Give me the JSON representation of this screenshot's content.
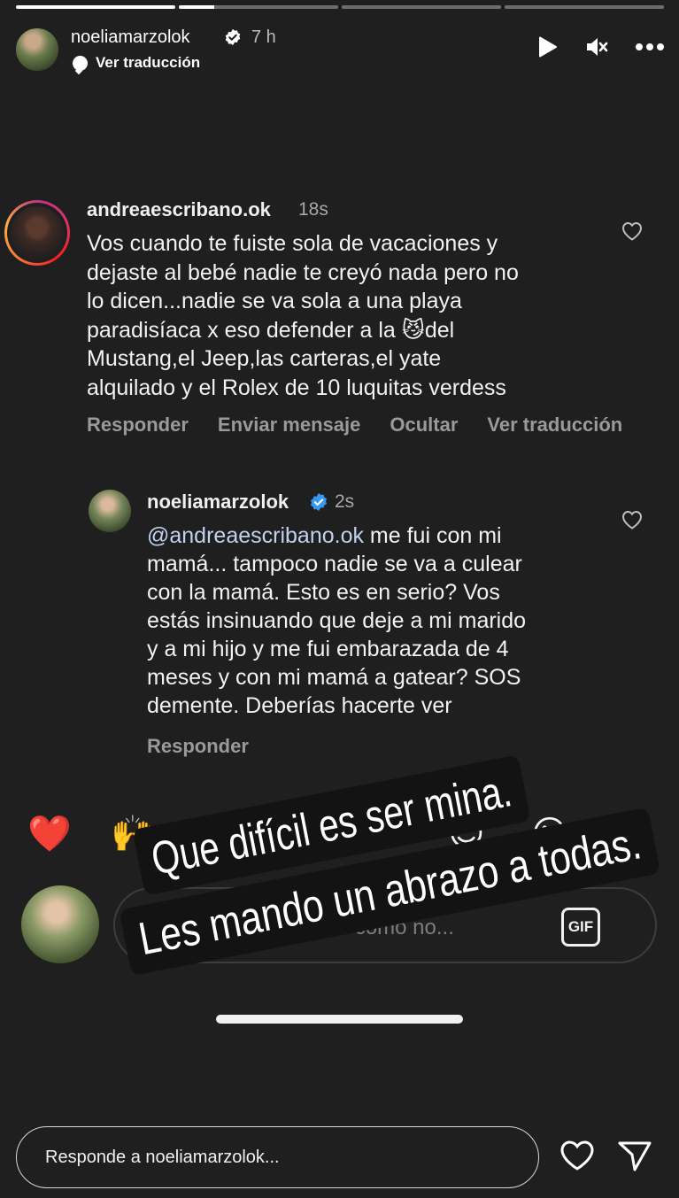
{
  "progress": {
    "segments": [
      {
        "fill": 1.0
      },
      {
        "fill": 0.22
      },
      {
        "fill": 0
      },
      {
        "fill": 0
      }
    ]
  },
  "story_header": {
    "username": "noeliamarzolok",
    "time": "7 h",
    "translate_label": "Ver traducción",
    "icons": [
      "play-icon",
      "mute-icon",
      "more-icon"
    ]
  },
  "comment": {
    "username": "andreaescribano.ok",
    "time": "18s",
    "lines": [
      "Vos cuando te fuiste sola de vacaciones y",
      "dejaste al bebé nadie te creyó nada pero no",
      "lo dicen...nadie se va sola a una playa",
      "paradisíaca x eso defender a la 😼del",
      "Mustang,el Jeep,las carteras,el yate",
      "alquilado y el Rolex de 10 luquitas verdess"
    ],
    "actions": [
      "Responder",
      "Enviar mensaje",
      "Ocultar",
      "Ver traducción"
    ]
  },
  "reply": {
    "username": "noeliamarzolok",
    "time": "2s",
    "mention": "@andreaescribano.ok",
    "first_line_rest": " me fui con mi",
    "lines": [
      "mamá... tampoco nadie se va a culear",
      "con la mamá. Esto es en serio? Vos",
      "estás insinuando que deje a mi marido",
      "y a mi hijo y me fui embarazada de 4",
      "meses y con mi mamá a gatear? SOS",
      "demente. Deberías hacerte ver"
    ],
    "action": "Responder"
  },
  "emoji_reactions": [
    "❤️",
    "🙌",
    "🔥",
    "👏",
    "😢",
    "😍",
    "😮",
    "😂"
  ],
  "comment_input": {
    "placeholder": "Agrega un comentario como no...",
    "gif_label": "GIF"
  },
  "overlay_sticker": {
    "line1": "Que difícil es ser mina.",
    "line2": "Les mando un abrazo a todas."
  },
  "story_reply": {
    "placeholder": "Responde a noeliamarzolok..."
  },
  "colors": {
    "background": "#1f1f1f",
    "verified": "#3897f0",
    "muted_text": "#9a9a9a",
    "mention": "#c0d2ee"
  }
}
